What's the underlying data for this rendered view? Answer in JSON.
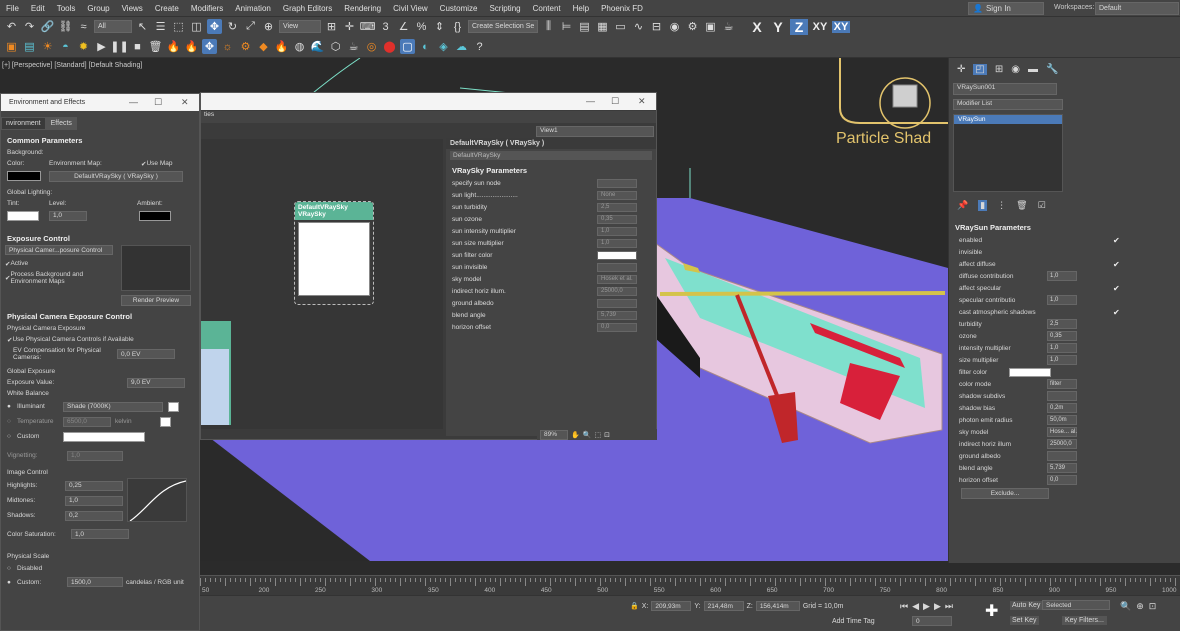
{
  "menu": [
    "File",
    "Edit",
    "Tools",
    "Group",
    "Views",
    "Create",
    "Modifiers",
    "Animation",
    "Graph Editors",
    "Rendering",
    "Civil View",
    "Customize",
    "Scripting",
    "Content",
    "Help",
    "Phoenix FD"
  ],
  "header": {
    "signin": "Sign In",
    "workspaces_label": "Workspaces:",
    "workspaces_value": "Default"
  },
  "toolbar": {
    "filter": "All",
    "ref_coord": "View",
    "selection_set": "Create Selection Se",
    "axes": [
      "X",
      "Y",
      "Z",
      "XY",
      "XY"
    ]
  },
  "viewport": {
    "label": "[+] [Perspective] [Standard] [Default Shading]",
    "scene_text": "Particle Shad"
  },
  "env": {
    "title": "Environment and Effects",
    "tabs": [
      "nvironment",
      "Effects"
    ],
    "common": "Common Parameters",
    "background": "Background:",
    "color": "Color:",
    "env_map": "Environment Map:",
    "use_map": "Use Map",
    "map_btn": "DefaultVRaySky ( VRaySky )",
    "global_lighting": "Global Lighting:",
    "tint": "Tint:",
    "level": "Level:",
    "level_val": "1,0",
    "ambient": "Ambient:",
    "exposure": "Exposure Control",
    "exposure_select": "Physical Camer...posure Control",
    "active": "Active",
    "process": "Process Background and Environment Maps",
    "render_preview": "Render Preview",
    "pcec": "Physical Camera Exposure Control",
    "pce": "Physical Camera Exposure",
    "use_pcc": "Use Physical Camera Controls if Available",
    "ev_comp": "EV Compensation for Physical Cameras:",
    "ev_comp_val": "0,0 EV",
    "global_exp": "Global Exposure",
    "exp_value": "Exposure Value:",
    "exp_value_val": "9,0 EV",
    "white_balance": "White Balance",
    "illuminant": "Illuminant",
    "illuminant_val": "Shade (7000K)",
    "temperature": "Temperature",
    "temperature_val": "6500,0",
    "kelvin": "kelvin",
    "custom": "Custom",
    "vignetting": "Vignetting:",
    "vignetting_val": "1,0",
    "image_control": "Image Control",
    "highlights": "Highlights:",
    "highlights_val": "0,25",
    "midtones": "Midtones:",
    "midtones_val": "1,0",
    "shadows": "Shadows:",
    "shadows_val": "0,2",
    "color_sat": "Color Saturation:",
    "color_sat_val": "1,0",
    "phys_scale": "Physical Scale",
    "disabled": "Disabled",
    "custom2": "Custom:",
    "custom2_val": "1500,0",
    "custom2_unit": "candelas / RGB unit"
  },
  "mat": {
    "views": "View1",
    "header": "DefaultVRaySky  ( VRaySky )",
    "name": "DefaultVRaySky",
    "rollout": "VRaySky Parameters",
    "node_title1": "DefaultVRaySky",
    "node_title2": "VRaySky",
    "zoom": "89%",
    "partial_label": "ties",
    "params": [
      {
        "label": "specify sun node",
        "val": ""
      },
      {
        "label": "sun light.......................",
        "val": "None"
      },
      {
        "label": "sun turbidity",
        "val": "2,5"
      },
      {
        "label": "sun ozone",
        "val": "0,35"
      },
      {
        "label": "sun intensity multiplier",
        "val": "1,0"
      },
      {
        "label": "sun size multiplier",
        "val": "1,0"
      },
      {
        "label": "sun filter color",
        "val": ""
      },
      {
        "label": "sun invisible",
        "val": ""
      },
      {
        "label": "sky model",
        "val": "Hosek et al."
      },
      {
        "label": "indirect horiz illum.",
        "val": "25000,0"
      },
      {
        "label": "ground albedo",
        "val": ""
      },
      {
        "label": "blend angle",
        "val": "5,739"
      },
      {
        "label": "horizon offset",
        "val": "0,0"
      }
    ]
  },
  "cmd": {
    "object_name": "VRaySun001",
    "modifier_list": "Modifier List",
    "stack_item": "VRaySun",
    "rollout": "VRaySun Parameters",
    "params": [
      {
        "label": "enabled",
        "val": "✔"
      },
      {
        "label": "invisible",
        "val": ""
      },
      {
        "label": "affect diffuse",
        "val": "✔"
      },
      {
        "label": "diffuse contribution",
        "val": "1,0"
      },
      {
        "label": "affect specular",
        "val": "✔"
      },
      {
        "label": "specular contributio",
        "val": "1,0"
      },
      {
        "label": "cast atmospheric shadows",
        "val": "✔"
      },
      {
        "label": "turbidity",
        "val": "2,5"
      },
      {
        "label": "ozone",
        "val": "0,35"
      },
      {
        "label": "intensity multiplier",
        "val": "1,0"
      },
      {
        "label": "size multiplier",
        "val": "1,0"
      },
      {
        "label": "color mode",
        "val": "filter"
      },
      {
        "label": "shadow subdivs",
        "val": ""
      },
      {
        "label": "shadow bias",
        "val": "0,2m"
      },
      {
        "label": "photon emit radius",
        "val": "50,0m"
      },
      {
        "label": "sky model",
        "val": "Hose... al."
      },
      {
        "label": "indirect horiz illum",
        "val": "25000,0"
      },
      {
        "label": "ground albedo",
        "val": ""
      },
      {
        "label": "blend angle",
        "val": "5,739"
      },
      {
        "label": "horizon offset",
        "val": "0,0"
      }
    ],
    "color_label": "filter color",
    "exclude": "Exclude..."
  },
  "timeline": {
    "ticks": [
      "50",
      "200",
      "250",
      "300",
      "350",
      "400",
      "450",
      "500",
      "550",
      "600",
      "650",
      "700",
      "750",
      "800",
      "850",
      "900",
      "950",
      "1000"
    ]
  },
  "status": {
    "x_label": "X:",
    "x": "209,93m",
    "y_label": "Y:",
    "y": "214,48m",
    "z_label": "Z:",
    "z": "156,414m",
    "grid": "Grid = 10,0m",
    "add_time_tag": "Add Time Tag",
    "auto_key": "Auto Key",
    "selected": "Selected",
    "set_key": "Set Key",
    "key_filters": "Key Filters...",
    "frame": "0"
  }
}
